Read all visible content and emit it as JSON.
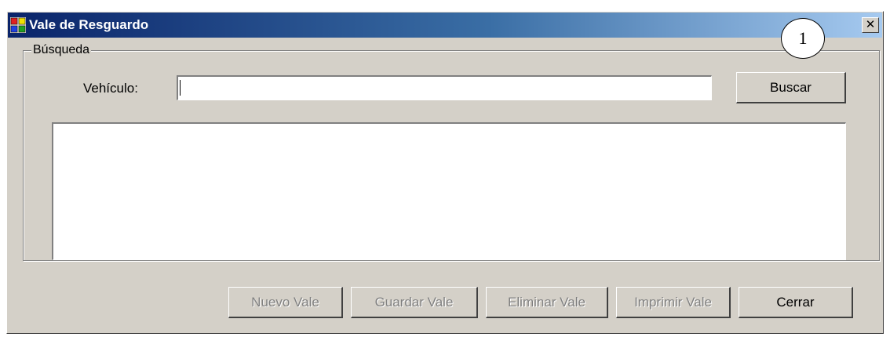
{
  "window": {
    "title": "Vale de Resguardo",
    "close_label": "✕"
  },
  "annotation": {
    "callout_number": "1"
  },
  "search_group": {
    "label": "Búsqueda",
    "vehicle_label": "Vehículo:",
    "vehicle_value": "",
    "search_button": "Buscar"
  },
  "results": {
    "items": []
  },
  "actions": {
    "nuevo": "Nuevo Vale",
    "guardar": "Guardar Vale",
    "eliminar": "Eliminar Vale",
    "imprimir": "Imprimir Vale",
    "cerrar": "Cerrar"
  },
  "colors": {
    "titlebar_start": "#0a246a",
    "titlebar_end": "#a6caf0",
    "window_face": "#d4d0c8"
  }
}
